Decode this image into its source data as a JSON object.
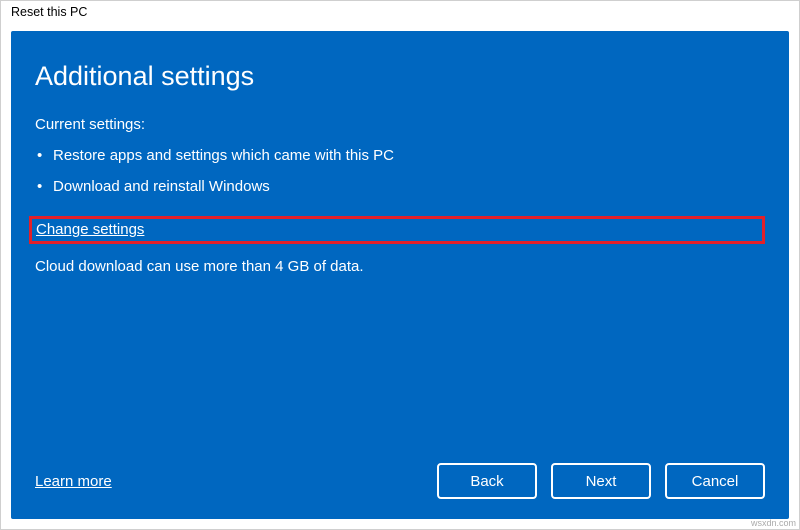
{
  "window": {
    "title": "Reset this PC"
  },
  "page": {
    "heading": "Additional settings",
    "current_label": "Current settings:",
    "bullets": [
      "Restore apps and settings which came with this PC",
      "Download and reinstall Windows"
    ],
    "change_link": "Change settings",
    "note": "Cloud download can use more than 4 GB of data."
  },
  "footer": {
    "learn_more": "Learn more",
    "back": "Back",
    "next": "Next",
    "cancel": "Cancel"
  },
  "watermark": "wsxdn.com"
}
